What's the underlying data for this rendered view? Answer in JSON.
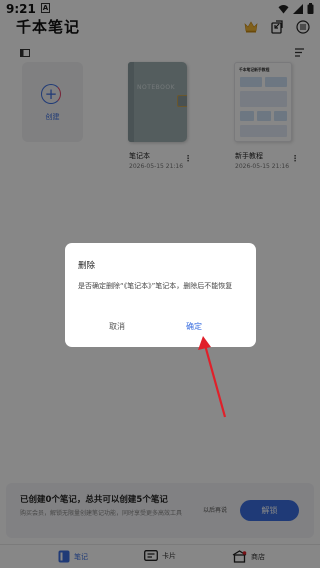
{
  "status_bar": {
    "time": "9:21",
    "badge": "A"
  },
  "app": {
    "title": "千本笔记"
  },
  "create_card": {
    "label": "创建"
  },
  "notebooks": [
    {
      "cover_text": "NOTEBOOK",
      "title": "笔记本",
      "date": "2026-05-15 21:16"
    },
    {
      "cover_text": "千本笔记新手教程",
      "title": "新手教程",
      "date": "2026-05-15 21:16"
    }
  ],
  "dialog": {
    "title": "删除",
    "message": "是否确定删除“《笔记本》”笔记本，删除后不能恢复",
    "cancel": "取消",
    "confirm": "确定"
  },
  "promo": {
    "title": "已创建0个笔记，总共可以创建5个笔记",
    "desc": "购买会员，解锁无限量创建笔记功能，同时享受更多高效工具",
    "later": "以后再说",
    "unlock": "解锁"
  },
  "tabs": [
    {
      "label": "笔记",
      "icon": "notebook-icon",
      "active": true
    },
    {
      "label": "卡片",
      "icon": "card-icon",
      "active": false
    },
    {
      "label": "商店",
      "icon": "store-icon",
      "active": false
    }
  ],
  "colors": {
    "accent": "#3b6fe0",
    "arrow": "#e0202a",
    "notebook_cover": "#9fb0b2"
  }
}
